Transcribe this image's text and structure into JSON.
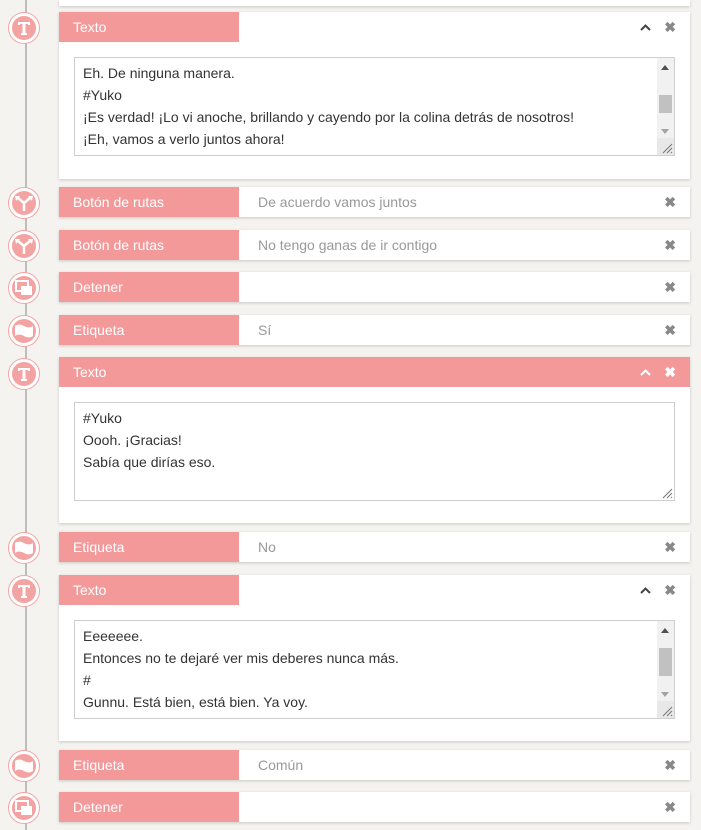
{
  "items": [
    {
      "label": "Texto",
      "icon": "text-t-icon",
      "lines": [
        "Eh. De ninguna manera.",
        "#Yuko",
        "¡Es verdad! ¡Lo vi anoche, brillando y cayendo por la colina detrás de nosotros!",
        "¡Eh, vamos a verlo juntos ahora!"
      ]
    },
    {
      "label": "Botón de rutas",
      "icon": "route-split-icon",
      "value": "De acuerdo vamos juntos"
    },
    {
      "label": "Botón de rutas",
      "icon": "route-split-icon",
      "value": "No tengo ganas de ir contigo"
    },
    {
      "label": "Detener",
      "icon": "stop-window-icon",
      "value": ""
    },
    {
      "label": "Etiqueta",
      "icon": "flag-icon",
      "value": "Sí"
    },
    {
      "label": "Texto",
      "icon": "text-t-icon",
      "active": true,
      "lines": [
        "#Yuko",
        "Oooh. ¡Gracias!",
        "Sabía que dirías eso."
      ]
    },
    {
      "label": "Etiqueta",
      "icon": "flag-icon",
      "value": "No"
    },
    {
      "label": "Texto",
      "icon": "text-t-icon",
      "lines": [
        "Eeeeeee.",
        "Entonces no te dejaré ver mis deberes nunca más.",
        "#",
        "Gunnu. Está bien, está bien. Ya voy."
      ]
    },
    {
      "label": "Etiqueta",
      "icon": "flag-icon",
      "value": "Común"
    },
    {
      "label": "Detener",
      "icon": "stop-window-icon",
      "value": ""
    }
  ],
  "controls": {
    "collapse": "^",
    "delete": "✖"
  },
  "colors": {
    "accent": "#f4999a",
    "timeline": "#bdbdbd",
    "background": "#f5f3f0"
  }
}
